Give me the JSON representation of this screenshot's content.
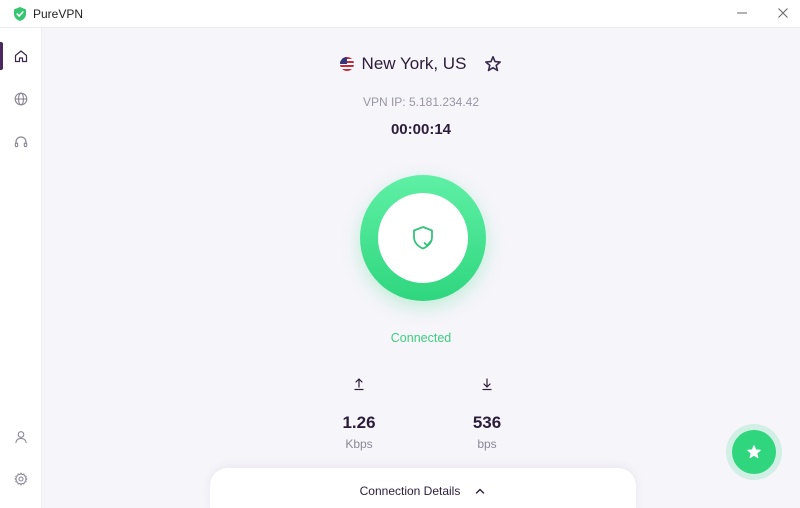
{
  "app": {
    "title": "PureVPN"
  },
  "window": {
    "minimize_icon": "minimize-icon",
    "close_icon": "close-icon"
  },
  "sidebar": {
    "items": [
      {
        "name": "home",
        "icon": "home-icon",
        "active": true
      },
      {
        "name": "locations",
        "icon": "globe-icon"
      },
      {
        "name": "support",
        "icon": "headset-icon"
      },
      {
        "name": "account",
        "icon": "user-icon"
      },
      {
        "name": "settings",
        "icon": "gear-icon"
      }
    ]
  },
  "connection": {
    "location": "New York,  US",
    "flag": "us-flag",
    "favorite_icon": "star-outline-icon",
    "ip_label": "VPN IP: 5.181.234.42",
    "timer": "00:00:14",
    "status": "Connected"
  },
  "stats": {
    "upload": {
      "value": "1.26",
      "unit": "Kbps",
      "icon": "upload-arrow-icon"
    },
    "download": {
      "value": "536",
      "unit": "bps",
      "icon": "download-arrow-icon"
    }
  },
  "details": {
    "label": "Connection Details",
    "icon": "chevron-up-icon"
  },
  "colors": {
    "accent": "#2fd67e",
    "brand_dark": "#2b1d3a",
    "status": "#3fcf80"
  }
}
